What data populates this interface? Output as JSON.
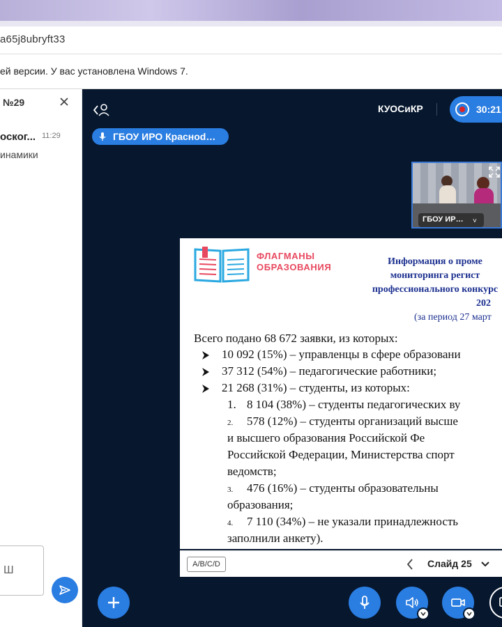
{
  "browser": {
    "address_text": "а65j8ubryft33",
    "warning_text": "ей версии. У вас установлена Windows 7."
  },
  "chat": {
    "header_number": "№29",
    "item": {
      "name": "оског...",
      "time": "11:29",
      "message": "инамики"
    },
    "input_placeholder": "Ш"
  },
  "room": {
    "title": "КУОСиКР",
    "record_time": "30:21",
    "presenter": "ГБОУ ИРО Красноd…"
  },
  "video": {
    "label": "ГБОУ ИР…"
  },
  "slide": {
    "logo_line1": "ФЛАГМАНЫ",
    "logo_line2": "ОБРАЗОВАНИЯ",
    "title_lines": [
      "Информация о проме",
      "мониторинга регист",
      "профессионального конкурс",
      "202"
    ],
    "period": "(за период 27 март",
    "intro": "Всего подано 68 672 заявки, из которых:",
    "bullets": [
      "10 092 (15%) – управленцы в сфере образовани",
      "37 312 (54%) – педагогические работники;",
      "21 268 (31%) – студенты, из которых:"
    ],
    "sub1_num": "1.",
    "sub1": "8 104 (38%) – студенты педагогических  ву",
    "sub2_num": "2.",
    "sub2_line1": "578 (12%) – студенты организаций высше",
    "sub2_line2": "и   высшего   образования   Российской   Фе",
    "sub2_line3": "Российской Федерации, Министерства спорт",
    "sub2_line4": "ведомств;",
    "sub3_num": "3.",
    "sub3_line1": "476   (16%)   –   студенты   образовательны",
    "sub3_line2": "образования;",
    "sub4_num": "4.",
    "sub4_line1": "7 110 (34%) – не указали принадлежность",
    "sub4_line2": "заполнили анкету)."
  },
  "slide_controls": {
    "abcd_label": "A/B/C/D",
    "slide_label": "Слайд 25"
  },
  "colors": {
    "accent": "#2a7de1",
    "background": "#06172e",
    "slide_title": "#1b2f8f",
    "logo": "#e8485f"
  }
}
